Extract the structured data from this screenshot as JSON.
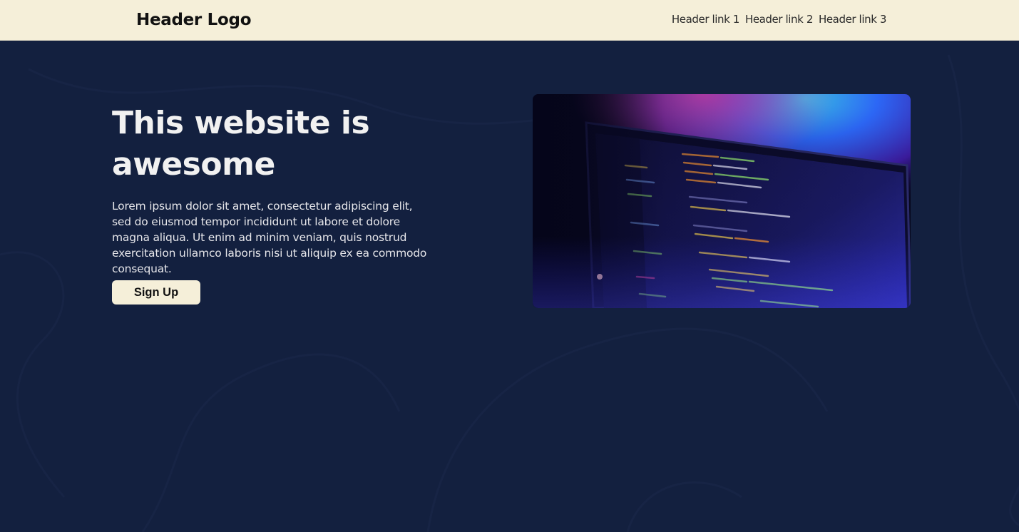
{
  "header": {
    "logo": "Header Logo",
    "links": [
      "Header link 1",
      "Header link 2",
      "Header link 3"
    ]
  },
  "hero": {
    "title": "This website is awesome",
    "text": "Lorem ipsum dolor sit amet, consectetur adipiscing elit, sed do eiusmod tempor incididunt ut labore et dolore magna aliqua. Ut enim ad minim veniam, quis nostrud exercitation ullamco laboris nisi ut aliquip ex ea commodo consequat.",
    "cta_label": "Sign Up"
  },
  "colors": {
    "page_background": "#13203f",
    "header_background": "#f5efd9",
    "button_background": "#f5efd9",
    "heading_text": "#f1f1f1"
  }
}
